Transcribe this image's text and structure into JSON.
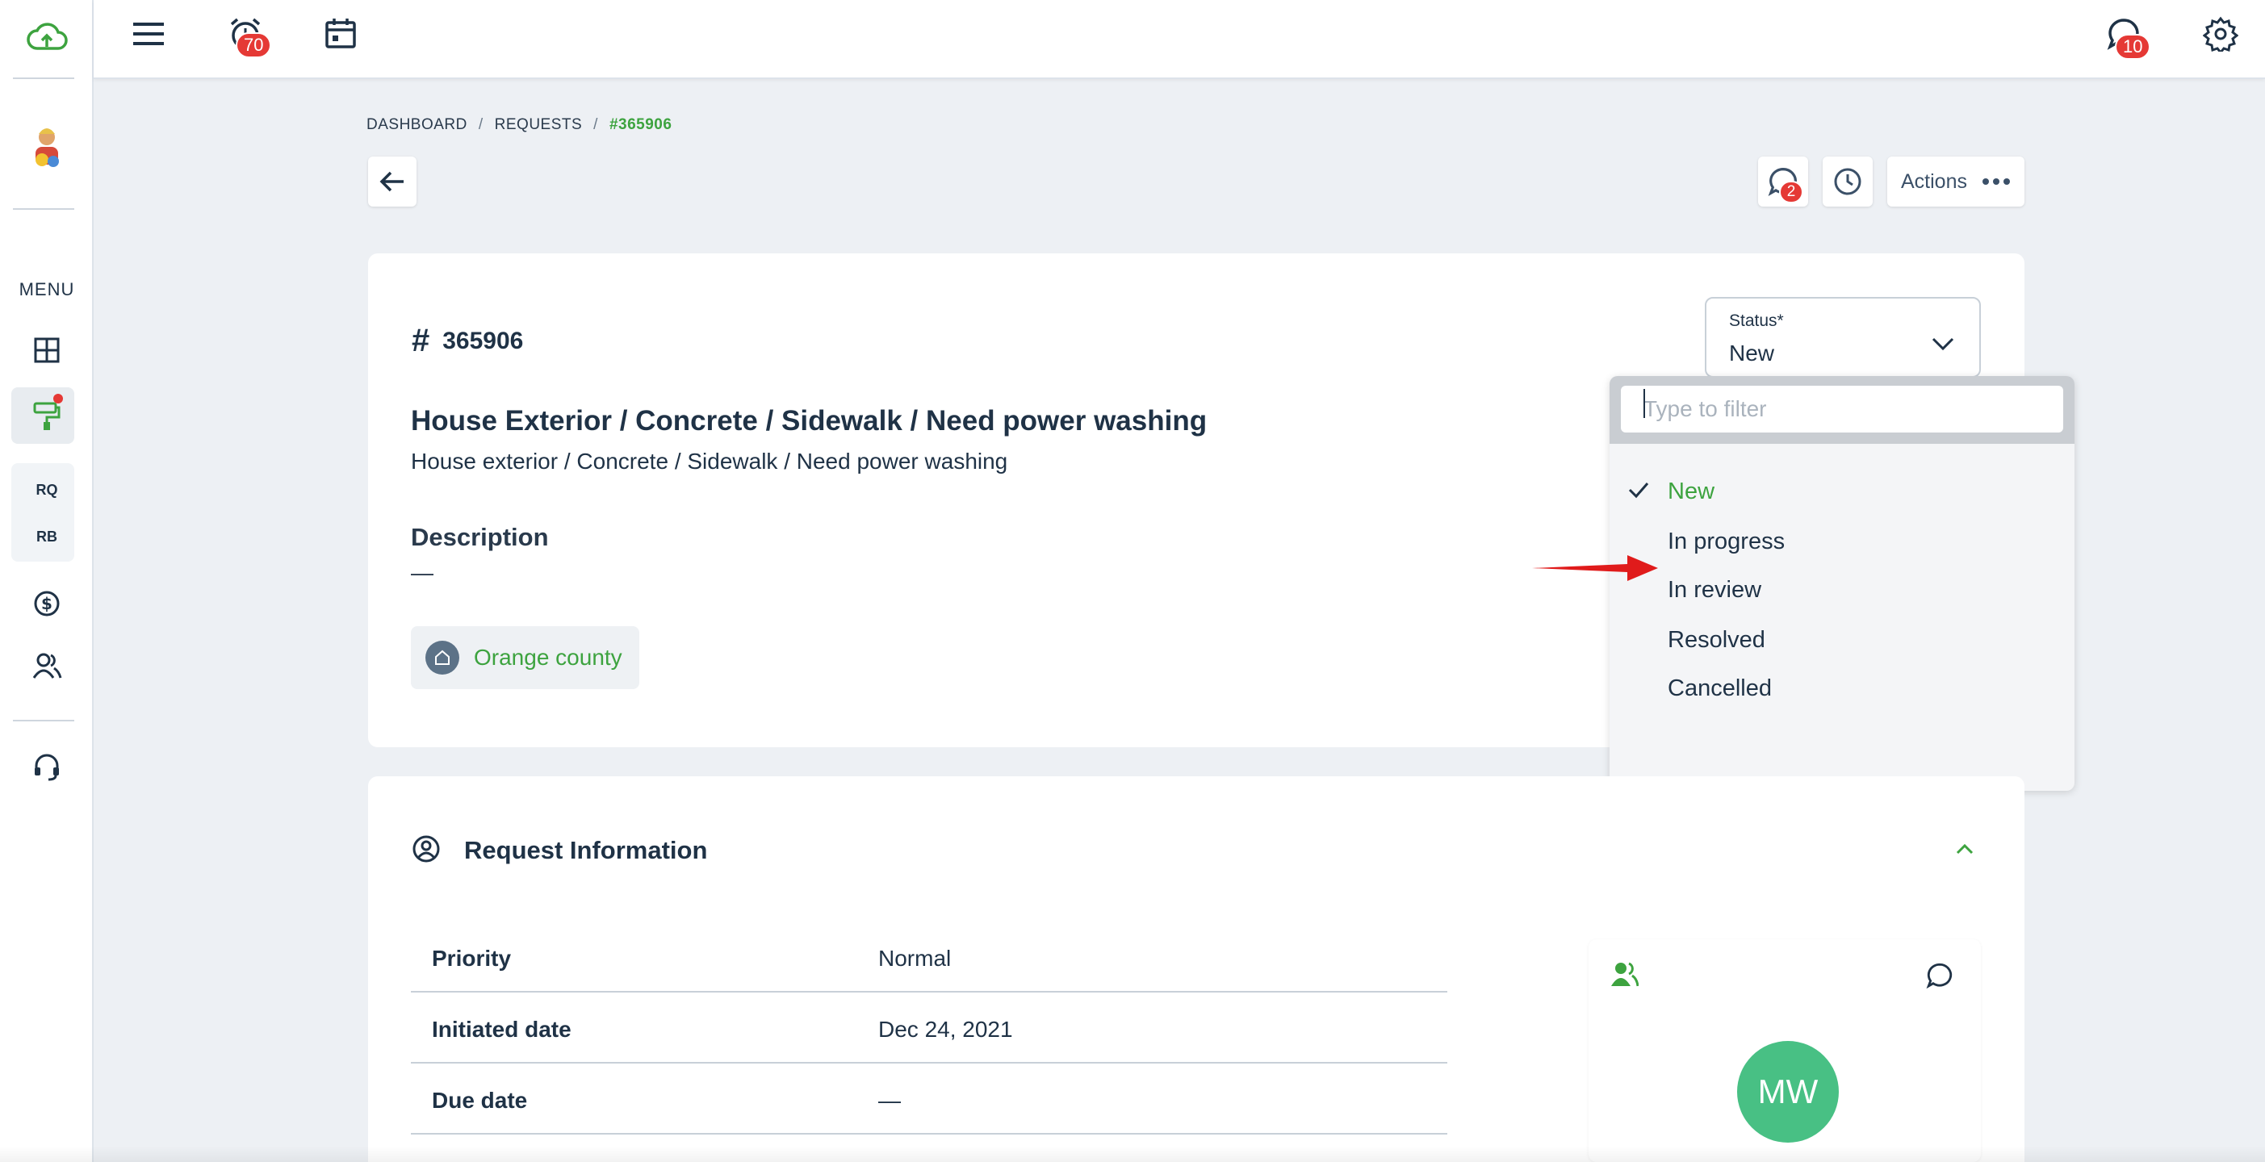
{
  "sidebar": {
    "menu_label": "MENU",
    "rq_label": "RQ",
    "rb_label": "RB"
  },
  "topbar": {
    "alarm_badge": "70",
    "chat_badge": "10"
  },
  "breadcrumb": {
    "items": [
      "DASHBOARD",
      "REQUESTS"
    ],
    "current": "#365906",
    "separator": "/"
  },
  "header_actions": {
    "comments_badge": "2",
    "actions_label": "Actions"
  },
  "request": {
    "id": "365906",
    "title": "House Exterior / Concrete / Sidewalk / Need power washing",
    "subtitle": "House exterior / Concrete / Sidewalk / Need power washing",
    "description_label": "Description",
    "description_value": "—",
    "location_tag": "Orange county"
  },
  "status": {
    "label": "Status*",
    "value": "New",
    "filter_placeholder": "Type to filter",
    "options": [
      "New",
      "In progress",
      "In review",
      "Resolved",
      "Cancelled"
    ],
    "selected": "New"
  },
  "request_info": {
    "title": "Request Information",
    "rows": [
      {
        "key": "Priority",
        "value": "Normal"
      },
      {
        "key": "Initiated date",
        "value": "Dec 24, 2021"
      },
      {
        "key": "Due date",
        "value": "—"
      }
    ],
    "assignee_initials": "MW"
  },
  "colors": {
    "accent_green": "#3da33f",
    "badge_red": "#e53935",
    "avatar_green": "#48c084"
  }
}
